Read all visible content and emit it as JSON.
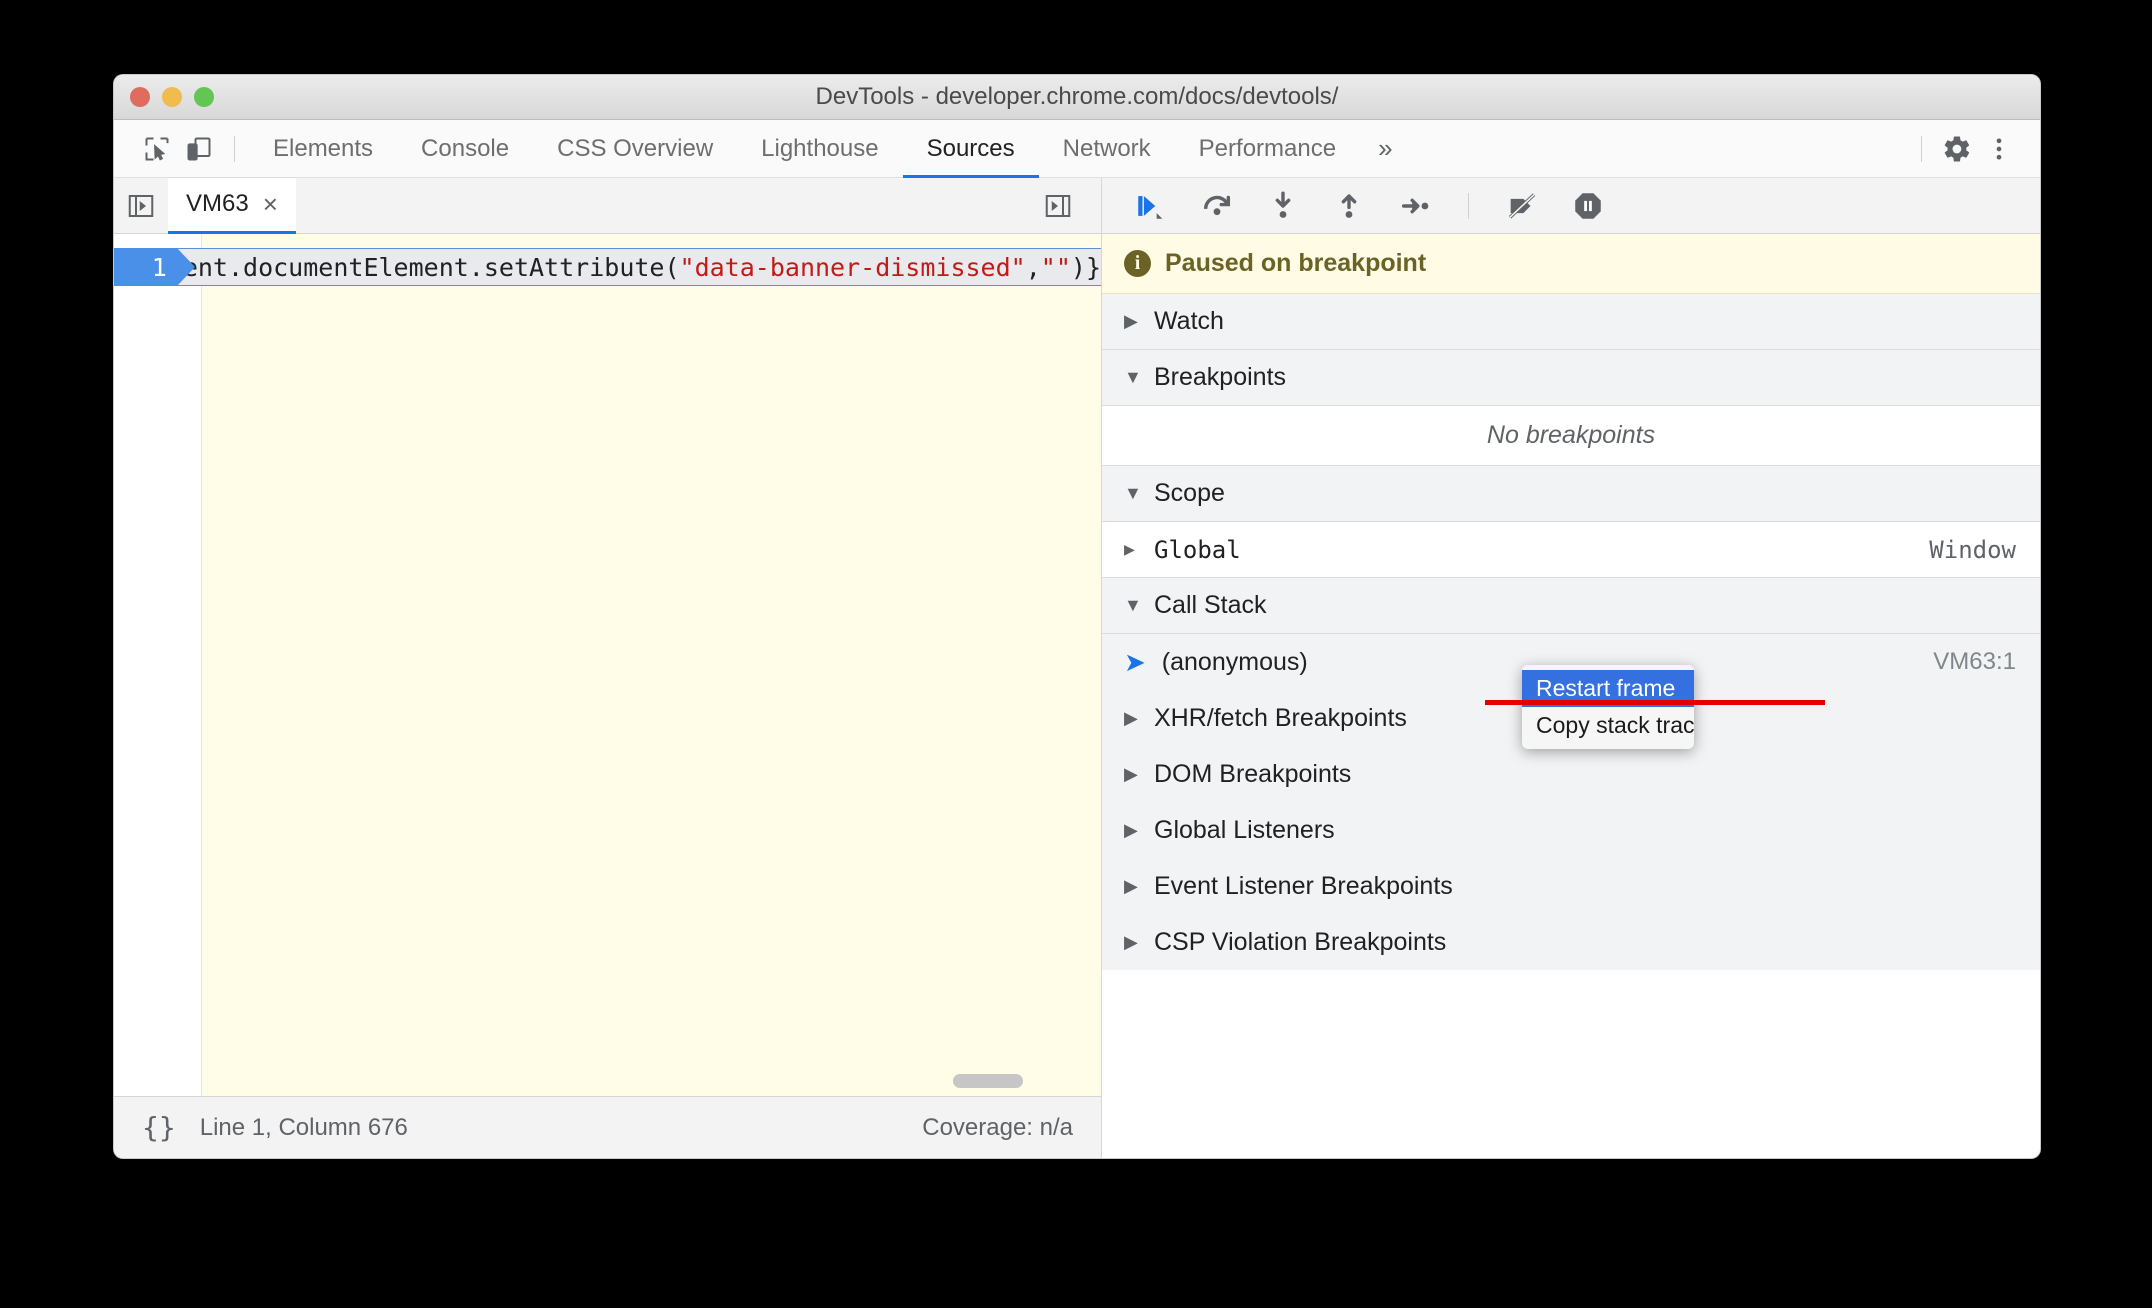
{
  "window": {
    "title": "DevTools - developer.chrome.com/docs/devtools/",
    "traffic": {
      "close": "close-button",
      "minimize": "minimize-button",
      "zoom": "zoom-button"
    }
  },
  "toolbar": {
    "inspect_icon": "inspect-element-icon",
    "device_icon": "device-toolbar-icon",
    "tabs": [
      {
        "label": "Elements",
        "active": false
      },
      {
        "label": "Console",
        "active": false
      },
      {
        "label": "CSS Overview",
        "active": false
      },
      {
        "label": "Lighthouse",
        "active": false
      },
      {
        "label": "Sources",
        "active": true
      },
      {
        "label": "Network",
        "active": false
      },
      {
        "label": "Performance",
        "active": false
      }
    ],
    "more_tabs": "»",
    "settings_icon": "gear-icon",
    "menu_icon": "more-vertical-icon"
  },
  "editor": {
    "sidebar_toggle_icon": "show-navigator-icon",
    "navigator_toggle_icon": "show-debugger-icon",
    "file_tab": {
      "name": "VM63",
      "close": "×"
    },
    "line_number": "1",
    "code_prefix": "ent.documentElement.setAttribute(",
    "code_string1": "\"data-banner-dismissed\"",
    "code_comma": ",",
    "code_string2": "\"\"",
    "code_suffix": ")}",
    "status": {
      "pretty_print": "{}",
      "position": "Line 1, Column 676",
      "coverage": "Coverage: n/a"
    }
  },
  "debugger": {
    "controls": [
      {
        "name": "resume-script-execution",
        "icon": "resume-icon"
      },
      {
        "name": "step-over-next-function-call",
        "icon": "step-over-icon"
      },
      {
        "name": "step-into-next-function-call",
        "icon": "step-into-icon"
      },
      {
        "name": "step-out-of-current-function",
        "icon": "step-out-icon"
      },
      {
        "name": "step",
        "icon": "step-icon"
      },
      {
        "name": "deactivate-breakpoints",
        "icon": "deactivate-breakpoints-icon"
      },
      {
        "name": "pause-on-exceptions",
        "icon": "pause-on-exceptions-icon"
      }
    ],
    "paused_banner": {
      "icon": "info-icon",
      "text": "Paused on breakpoint"
    },
    "sections": {
      "watch": {
        "label": "Watch",
        "expanded": false
      },
      "breakpoints": {
        "label": "Breakpoints",
        "expanded": true,
        "empty_text": "No breakpoints"
      },
      "scope": {
        "label": "Scope",
        "expanded": true,
        "rows": [
          {
            "name": "Global",
            "value": "Window"
          }
        ]
      },
      "call_stack": {
        "label": "Call Stack",
        "expanded": true,
        "frames": [
          {
            "name": "(anonymous)",
            "location": "VM63:1",
            "selected": true
          }
        ]
      },
      "other": [
        {
          "label": "XHR/fetch Breakpoints",
          "expanded": false
        },
        {
          "label": "DOM Breakpoints",
          "expanded": false
        },
        {
          "label": "Global Listeners",
          "expanded": false
        },
        {
          "label": "Event Listener Breakpoints",
          "expanded": false
        },
        {
          "label": "CSP Violation Breakpoints",
          "expanded": false
        }
      ]
    }
  },
  "context_menu": {
    "items": [
      {
        "label": "Restart frame",
        "highlighted": true
      },
      {
        "label": "Copy stack trace",
        "highlighted": false
      }
    ]
  },
  "annotation": {
    "strikethrough_color": "#e50000"
  },
  "glyphs": {
    "collapsed": "▶",
    "expanded": "▼",
    "frame_arrow": "➡"
  }
}
